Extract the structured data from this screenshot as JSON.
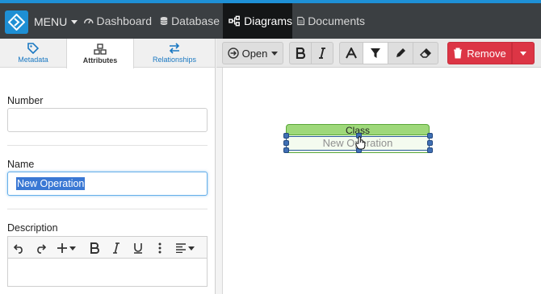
{
  "topbar": {
    "menu_label": "MENU",
    "nav": [
      {
        "label": "Dashboard",
        "icon": "dashboard-icon"
      },
      {
        "label": "Database",
        "icon": "database-icon"
      },
      {
        "label": "Diagrams",
        "icon": "diagrams-icon",
        "active": true
      },
      {
        "label": "Documents",
        "icon": "document-icon"
      }
    ]
  },
  "tabs": [
    {
      "label": "Metadata",
      "icon": "tag-icon"
    },
    {
      "label": "Attributes",
      "icon": "cubes-icon",
      "active": true
    },
    {
      "label": "Relationships",
      "icon": "exchange-icon"
    }
  ],
  "form": {
    "number_label": "Number",
    "number_value": "",
    "name_label": "Name",
    "name_value": "New Operation",
    "description_label": "Description"
  },
  "diagram_toolbar": {
    "open_label": "Open",
    "remove_label": "Remove"
  },
  "canvas": {
    "class_name": "Class",
    "operation_text": "New Operation"
  },
  "colors": {
    "accent": "#1e8fd4",
    "topbar": "#3b3f42",
    "remove": "#dc3545",
    "class_header": "#9ed87a"
  }
}
